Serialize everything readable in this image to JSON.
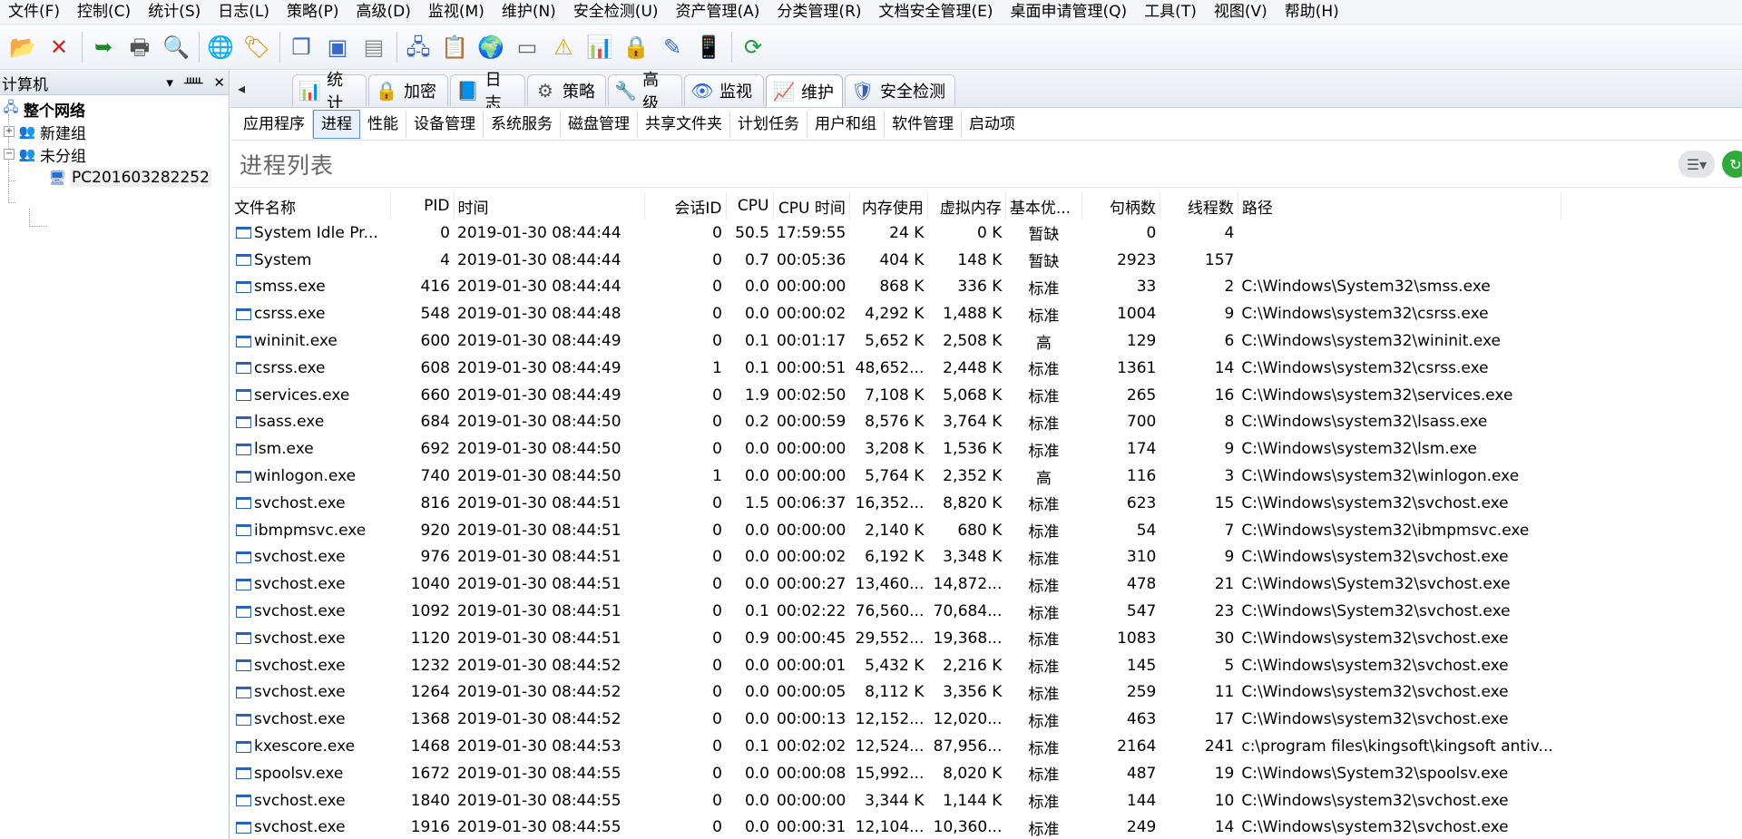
{
  "menu": [
    "文件(F)",
    "控制(C)",
    "统计(S)",
    "日志(L)",
    "策略(P)",
    "高级(D)",
    "监视(M)",
    "维护(N)",
    "安全检测(U)",
    "资产管理(A)",
    "分类管理(R)",
    "文档安全管理(E)",
    "桌面申请管理(Q)",
    "工具(T)",
    "视图(V)",
    "帮助(H)"
  ],
  "toolbar": {
    "buttons": [
      {
        "name": "new-folder-icon",
        "glyph": "📂"
      },
      {
        "name": "delete-icon",
        "glyph": "✕"
      },
      {
        "name": "import-icon",
        "glyph": "➥"
      },
      {
        "name": "print-icon",
        "glyph": "🖶"
      },
      {
        "name": "print-preview-icon",
        "glyph": "🔍"
      },
      {
        "name": "globe-person-icon",
        "glyph": "🌐"
      },
      {
        "name": "tag-icon",
        "glyph": "🏷"
      },
      {
        "name": "copy-icon",
        "glyph": "❐"
      },
      {
        "name": "window-icon",
        "glyph": "▣"
      },
      {
        "name": "window-alt-icon",
        "glyph": "▤"
      },
      {
        "name": "network-icon",
        "glyph": "🖧"
      },
      {
        "name": "report-icon",
        "glyph": "📋"
      },
      {
        "name": "earth-icon",
        "glyph": "🌍"
      },
      {
        "name": "device-icon",
        "glyph": "▭"
      },
      {
        "name": "warning-icon",
        "glyph": "⚠"
      },
      {
        "name": "chart-icon",
        "glyph": "📊"
      },
      {
        "name": "lock-icon",
        "glyph": "🔒"
      },
      {
        "name": "edit-icon",
        "glyph": "✎"
      },
      {
        "name": "mobile-icon",
        "glyph": "📱"
      },
      {
        "name": "refresh-icon",
        "glyph": "⟳"
      }
    ]
  },
  "leftpane": {
    "title": "计算机",
    "pin": "▾",
    "pin2": "ᚊ",
    "close": "✕",
    "tree": {
      "root": "整个网络",
      "group1": "新建组",
      "group2": "未分组",
      "computer": "PC201603282252"
    }
  },
  "tabs": [
    {
      "label": "统计",
      "glyph": "📊"
    },
    {
      "label": "加密",
      "glyph": "🔒"
    },
    {
      "label": "日志",
      "glyph": "📘"
    },
    {
      "label": "策略",
      "glyph": "⚙"
    },
    {
      "label": "高级",
      "glyph": "🔧"
    },
    {
      "label": "监视",
      "glyph": "👁"
    },
    {
      "label": "维护",
      "glyph": "📈"
    },
    {
      "label": "安全检测",
      "glyph": "🛡"
    }
  ],
  "tab_scroll": "◂",
  "subtabs": [
    "应用程序",
    "进程",
    "性能",
    "设备管理",
    "系统服务",
    "磁盘管理",
    "共享文件夹",
    "计划任务",
    "用户和组",
    "软件管理",
    "启动项"
  ],
  "section": {
    "title": "进程列表",
    "menu_glyph": "☰▾",
    "go_glyph": "↻"
  },
  "table": {
    "columns": [
      "文件名称",
      "PID",
      "时间",
      "会话ID",
      "CPU",
      "CPU 时间",
      "内存使用",
      "虚拟内存",
      "基本优...",
      "句柄数",
      "线程数",
      "路径"
    ],
    "rows": [
      [
        "System Idle Pr...",
        "0",
        "2019-01-30 08:44:44",
        "0",
        "50.5",
        "17:59:55",
        "24 K",
        "0 K",
        "暂缺",
        "0",
        "4",
        ""
      ],
      [
        "System",
        "4",
        "2019-01-30 08:44:44",
        "0",
        "0.7",
        "00:05:36",
        "404 K",
        "148 K",
        "暂缺",
        "2923",
        "157",
        ""
      ],
      [
        "smss.exe",
        "416",
        "2019-01-30 08:44:44",
        "0",
        "0.0",
        "00:00:00",
        "868 K",
        "336 K",
        "标准",
        "33",
        "2",
        "C:\\Windows\\System32\\smss.exe"
      ],
      [
        "csrss.exe",
        "548",
        "2019-01-30 08:44:48",
        "0",
        "0.0",
        "00:00:02",
        "4,292 K",
        "1,488 K",
        "标准",
        "1004",
        "9",
        "C:\\Windows\\system32\\csrss.exe"
      ],
      [
        "wininit.exe",
        "600",
        "2019-01-30 08:44:49",
        "0",
        "0.1",
        "00:01:17",
        "5,652 K",
        "2,508 K",
        "高",
        "129",
        "6",
        "C:\\Windows\\system32\\wininit.exe"
      ],
      [
        "csrss.exe",
        "608",
        "2019-01-30 08:44:49",
        "1",
        "0.1",
        "00:00:51",
        "48,652...",
        "2,448 K",
        "标准",
        "1361",
        "14",
        "C:\\Windows\\system32\\csrss.exe"
      ],
      [
        "services.exe",
        "660",
        "2019-01-30 08:44:49",
        "0",
        "1.9",
        "00:02:50",
        "7,108 K",
        "5,068 K",
        "标准",
        "265",
        "16",
        "C:\\Windows\\system32\\services.exe"
      ],
      [
        "lsass.exe",
        "684",
        "2019-01-30 08:44:50",
        "0",
        "0.2",
        "00:00:59",
        "8,576 K",
        "3,764 K",
        "标准",
        "700",
        "8",
        "C:\\Windows\\system32\\lsass.exe"
      ],
      [
        "lsm.exe",
        "692",
        "2019-01-30 08:44:50",
        "0",
        "0.0",
        "00:00:00",
        "3,208 K",
        "1,536 K",
        "标准",
        "174",
        "9",
        "C:\\Windows\\system32\\lsm.exe"
      ],
      [
        "winlogon.exe",
        "740",
        "2019-01-30 08:44:50",
        "1",
        "0.0",
        "00:00:00",
        "5,764 K",
        "2,352 K",
        "高",
        "116",
        "3",
        "C:\\Windows\\system32\\winlogon.exe"
      ],
      [
        "svchost.exe",
        "816",
        "2019-01-30 08:44:51",
        "0",
        "1.5",
        "00:06:37",
        "16,352...",
        "8,820 K",
        "标准",
        "623",
        "15",
        "C:\\Windows\\system32\\svchost.exe"
      ],
      [
        "ibmpmsvc.exe",
        "920",
        "2019-01-30 08:44:51",
        "0",
        "0.0",
        "00:00:00",
        "2,140 K",
        "680 K",
        "标准",
        "54",
        "7",
        "C:\\Windows\\system32\\ibmpmsvc.exe"
      ],
      [
        "svchost.exe",
        "976",
        "2019-01-30 08:44:51",
        "0",
        "0.0",
        "00:00:02",
        "6,192 K",
        "3,348 K",
        "标准",
        "310",
        "9",
        "C:\\Windows\\system32\\svchost.exe"
      ],
      [
        "svchost.exe",
        "1040",
        "2019-01-30 08:44:51",
        "0",
        "0.0",
        "00:00:27",
        "13,460...",
        "14,872...",
        "标准",
        "478",
        "21",
        "C:\\Windows\\System32\\svchost.exe"
      ],
      [
        "svchost.exe",
        "1092",
        "2019-01-30 08:44:51",
        "0",
        "0.1",
        "00:02:22",
        "76,560...",
        "70,684...",
        "标准",
        "547",
        "23",
        "C:\\Windows\\System32\\svchost.exe"
      ],
      [
        "svchost.exe",
        "1120",
        "2019-01-30 08:44:51",
        "0",
        "0.9",
        "00:00:45",
        "29,552...",
        "19,368...",
        "标准",
        "1083",
        "30",
        "C:\\Windows\\system32\\svchost.exe"
      ],
      [
        "svchost.exe",
        "1232",
        "2019-01-30 08:44:52",
        "0",
        "0.0",
        "00:00:01",
        "5,432 K",
        "2,216 K",
        "标准",
        "145",
        "5",
        "C:\\Windows\\system32\\svchost.exe"
      ],
      [
        "svchost.exe",
        "1264",
        "2019-01-30 08:44:52",
        "0",
        "0.0",
        "00:00:05",
        "8,112 K",
        "3,356 K",
        "标准",
        "259",
        "11",
        "C:\\Windows\\system32\\svchost.exe"
      ],
      [
        "svchost.exe",
        "1368",
        "2019-01-30 08:44:52",
        "0",
        "0.0",
        "00:00:13",
        "12,152...",
        "12,020...",
        "标准",
        "463",
        "17",
        "C:\\Windows\\system32\\svchost.exe"
      ],
      [
        "kxescore.exe",
        "1468",
        "2019-01-30 08:44:53",
        "0",
        "0.1",
        "00:02:02",
        "12,524...",
        "87,956...",
        "标准",
        "2164",
        "241",
        "c:\\program files\\kingsoft\\kingsoft antiv..."
      ],
      [
        "spoolsv.exe",
        "1672",
        "2019-01-30 08:44:55",
        "0",
        "0.0",
        "00:00:08",
        "15,992...",
        "8,020 K",
        "标准",
        "487",
        "19",
        "C:\\Windows\\System32\\spoolsv.exe"
      ],
      [
        "svchost.exe",
        "1840",
        "2019-01-30 08:44:55",
        "0",
        "0.0",
        "00:00:00",
        "3,344 K",
        "1,144 K",
        "标准",
        "144",
        "10",
        "C:\\Windows\\system32\\svchost.exe"
      ],
      [
        "svchost.exe",
        "1916",
        "2019-01-30 08:44:55",
        "0",
        "0.0",
        "00:00:31",
        "12,104...",
        "10,360...",
        "标准",
        "249",
        "14",
        "C:\\Windows\\system32\\svchost.exe"
      ]
    ]
  },
  "colors": {
    "accent": "#2b5fb8",
    "selected_tab_border": "#5b8fd6"
  }
}
